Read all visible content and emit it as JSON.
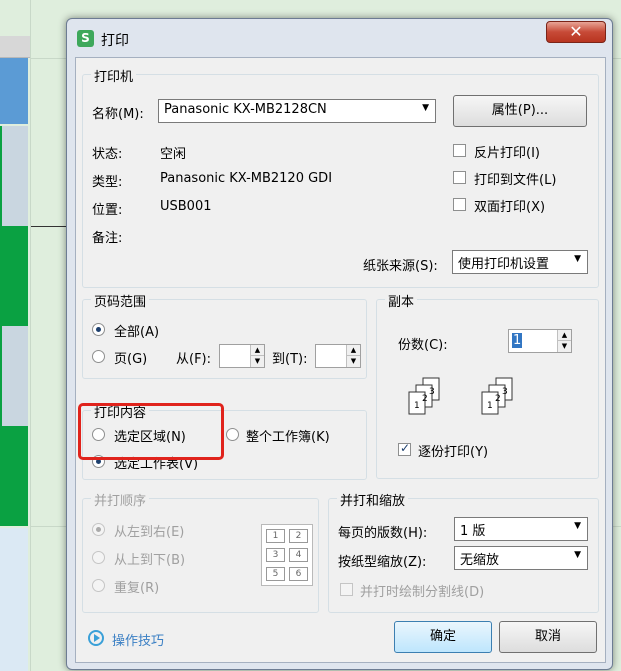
{
  "window": {
    "title": "打印",
    "app_icon_letter": "S",
    "close_symbol": "✕"
  },
  "printer": {
    "group_title": "打印机",
    "name_label": "名称(M):",
    "name_value": "Panasonic KX-MB2128CN",
    "properties_button": "属性(P)...",
    "status_label": "状态:",
    "status_value": "空闲",
    "type_label": "类型:",
    "type_value": "Panasonic KX-MB2120 GDI",
    "location_label": "位置:",
    "location_value": "USB001",
    "comment_label": "备注:",
    "reverse_print": {
      "label": "反片打印(I)",
      "checked": false
    },
    "print_to_file": {
      "label": "打印到文件(L)",
      "checked": false
    },
    "duplex": {
      "label": "双面打印(X)",
      "checked": false
    },
    "paper_source_label": "纸张来源(S):",
    "paper_source_value": "使用打印机设置"
  },
  "page_range": {
    "group_title": "页码范围",
    "all_label": "全部(A)",
    "pages_label": "页(G)",
    "from_label": "从(F):",
    "to_label": "到(T):",
    "selected": "all"
  },
  "copies": {
    "group_title": "副本",
    "count_label": "份数(C):",
    "count_value": "1",
    "collate": {
      "label": "逐份打印(Y)",
      "checked": true
    }
  },
  "print_content": {
    "group_title": "打印内容",
    "selection_label": "选定区域(N)",
    "workbook_label": "整个工作簿(K)",
    "sheet_label": "选定工作表(V)",
    "selected": "sheet"
  },
  "merge_order": {
    "group_title": "并打顺序",
    "left_to_right": "从左到右(E)",
    "top_to_bottom": "从上到下(B)",
    "repeat": "重复(R)",
    "selected": "left_to_right",
    "grid_numbers": [
      "1",
      "2",
      "3",
      "4",
      "5",
      "6"
    ]
  },
  "scaling": {
    "group_title": "并打和缩放",
    "pages_per_sheet_label": "每页的版数(H):",
    "pages_per_sheet_value": "1 版",
    "scale_label": "按纸型缩放(Z):",
    "scale_value": "无缩放",
    "draw_divider": {
      "label": "并打时绘制分割线(D)",
      "checked": false
    }
  },
  "footer": {
    "tips_link": "操作技巧",
    "ok_button": "确定",
    "cancel_button": "取消"
  },
  "colors": {
    "accent": "#3276c3",
    "highlight": "#e0231c",
    "sheet_green": "#0aa142",
    "sheet_blue": "#5b9bd5"
  }
}
